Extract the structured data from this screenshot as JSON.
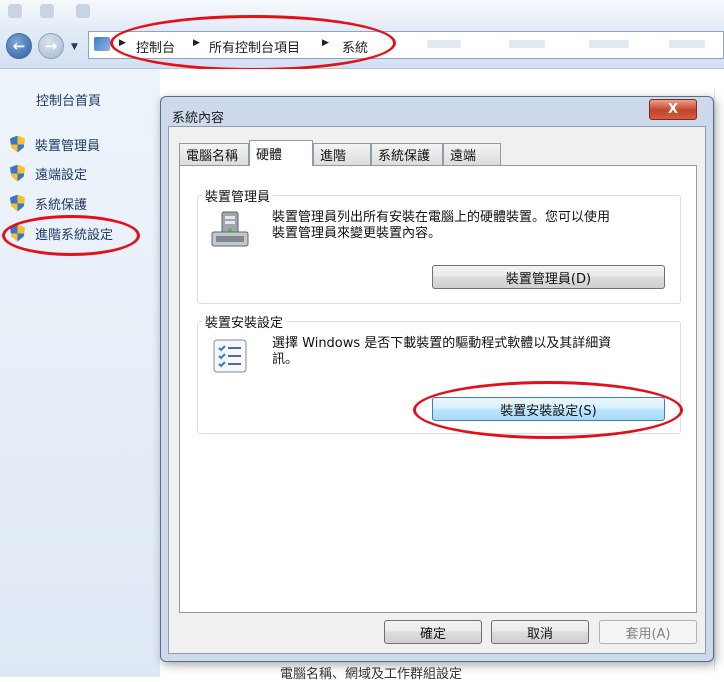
{
  "breadcrumb": {
    "items": [
      "控制台",
      "所有控制台項目",
      "系統"
    ]
  },
  "sidebar": {
    "home": "控制台首頁",
    "items": [
      {
        "label": "裝置管理員",
        "icon": "shield-icon"
      },
      {
        "label": "遠端設定",
        "icon": "shield-icon"
      },
      {
        "label": "系統保護",
        "icon": "shield-icon"
      },
      {
        "label": "進階系統設定",
        "icon": "shield-icon"
      }
    ]
  },
  "background": {
    "footer_text": "電腦名稱、網域及工作群組設定"
  },
  "dialog": {
    "title": "系統內容",
    "close_label": "X",
    "tabs": [
      "電腦名稱",
      "硬體",
      "進階",
      "系統保護",
      "遠端"
    ],
    "active_tab": "硬體",
    "device_manager": {
      "group_label": "裝置管理員",
      "line1": "裝置管理員列出所有安裝在電腦上的硬體裝置。您可以使用",
      "line2": "裝置管理員來變更裝置內容。",
      "button": "裝置管理員(D)"
    },
    "device_install": {
      "group_label": "裝置安裝設定",
      "line1": "選擇 Windows 是否下載裝置的驅動程式軟體以及其詳細資",
      "line2": "訊。",
      "button": "裝置安裝設定(S)"
    },
    "buttons": {
      "ok": "確定",
      "cancel": "取消",
      "apply": "套用(A)"
    }
  },
  "annotation_color": "#e3101a"
}
